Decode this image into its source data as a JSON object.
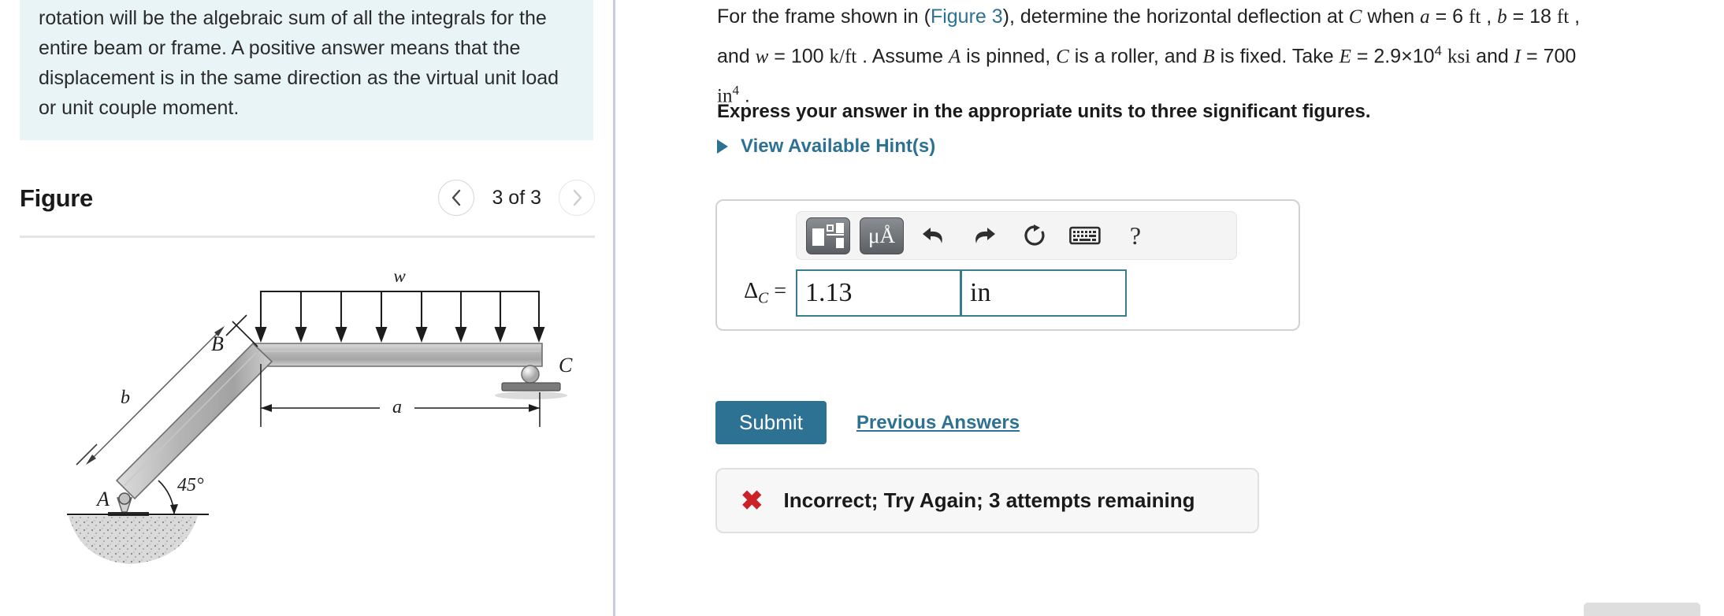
{
  "left": {
    "info_text": "desired displacement or rotation. The total displacement or rotation will be the algebraic sum of all the integrals for the entire beam or frame. A positive answer means that the displacement is in the same direction as the virtual unit load or unit couple moment.",
    "figure_title": "Figure",
    "pager": {
      "prev_icon": "chevron-left",
      "next_icon": "chevron-right",
      "count_label": "3 of 3"
    },
    "diagram": {
      "label_w": "w",
      "label_a": "a",
      "label_b": "b",
      "label_A": "A",
      "label_B": "B",
      "label_C": "C",
      "label_angle": "45°"
    }
  },
  "right": {
    "prompt": {
      "p1": "For the frame shown in (",
      "figure_link": "Figure 3",
      "p2": "), determine the horizontal deflection at ",
      "var_C": "C",
      "p3": " when ",
      "var_a": "a",
      "eq1": " = 6 ",
      "unit_ft1": "ft",
      "comma1": " , ",
      "var_b": "b",
      "eq2": " = 18 ",
      "unit_ft2": "ft",
      "comma2": " ,",
      "p4": "and ",
      "var_w": "w",
      "eq3": " = 100 ",
      "unit_kft": "k/ft",
      "p5": " . Assume ",
      "var_A": "A",
      "p6": " is pinned, ",
      "var_C2": "C",
      "p7": " is a roller, and ",
      "var_B": "B",
      "p8": " is fixed. Take ",
      "var_E": "E",
      "eq4": " = 2.9×10",
      "exp4": "4",
      "unit_ksi": "ksi",
      "p9": " and ",
      "var_I": "I",
      "eq5": " = 700",
      "unit_in": "in",
      "exp_in": "4",
      "period": " ."
    },
    "instruction": "Express your answer in the appropriate units to three significant figures.",
    "hints_label": "View Available Hint(s)",
    "answer": {
      "template_button_name": "math-template",
      "units_button_label": "μÅ",
      "undo_icon": "undo-arrow",
      "redo_icon": "redo-arrow",
      "reset_icon": "reset-circular-arrow",
      "keyboard_icon": "keyboard",
      "help_label": "?",
      "delta_symbol": "Δ",
      "delta_subscript": "C",
      "equals": "=",
      "value": "1.13",
      "value_placeholder": "",
      "units": "in",
      "units_placeholder": ""
    },
    "submit_label": "Submit",
    "previous_answers_label": "Previous Answers",
    "feedback": {
      "icon": "red-x",
      "icon_glyph": "✖",
      "text": "Incorrect; Try Again; 3 attempts remaining"
    }
  },
  "colors": {
    "accent": "#2d7193",
    "info_bg": "#e9f4f6",
    "input_border": "#3b7b90",
    "error": "#cc2128",
    "divider": "#c4cfdb"
  }
}
